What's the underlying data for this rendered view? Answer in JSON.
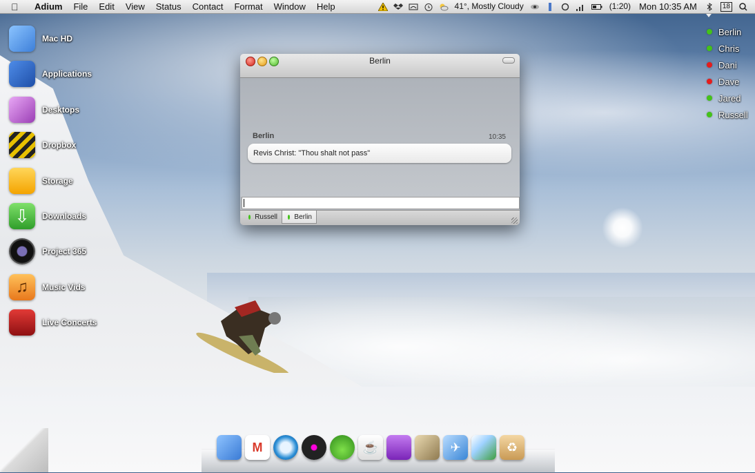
{
  "menubar": {
    "app": "Adium",
    "menus": [
      "File",
      "Edit",
      "View",
      "Status",
      "Contact",
      "Format",
      "Window",
      "Help"
    ],
    "weather": "41°, Mostly Cloudy",
    "battery": "(1:20)",
    "clock": "Mon 10:35 AM",
    "calendar_day": "18"
  },
  "desktop_icons": [
    {
      "label": "Mac HD",
      "icon": "finder-icon",
      "color": "#3d7fd9"
    },
    {
      "label": "Applications",
      "icon": "app-store-icon",
      "color": "#1f4fa8"
    },
    {
      "label": "Desktops",
      "icon": "desktops-icon",
      "color": "#9b3fb5"
    },
    {
      "label": "Dropbox",
      "icon": "dropbox-stripes-icon",
      "color": "#e8c100"
    },
    {
      "label": "Storage",
      "icon": "drive-icon",
      "color": "#f4b400"
    },
    {
      "label": "Downloads",
      "icon": "download-arrow-icon",
      "color": "#3fb53a"
    },
    {
      "label": "Project 365",
      "icon": "camera-lens-icon",
      "color": "#222222"
    },
    {
      "label": "Music Vids",
      "icon": "music-note-icon",
      "color": "#f08a1c"
    },
    {
      "label": "Live Concerts",
      "icon": "stage-icon",
      "color": "#b5191b"
    }
  ],
  "buddies": [
    {
      "name": "Berlin",
      "status": "online",
      "color": "#44c21a"
    },
    {
      "name": "Chris",
      "status": "online",
      "color": "#44c21a"
    },
    {
      "name": "Dani",
      "status": "away",
      "color": "#e51c1c"
    },
    {
      "name": "Dave",
      "status": "away",
      "color": "#e51c1c"
    },
    {
      "name": "Jared",
      "status": "online",
      "color": "#44c21a"
    },
    {
      "name": "Russell",
      "status": "online",
      "color": "#44c21a"
    }
  ],
  "chat": {
    "title": "Berlin",
    "message": {
      "sender": "Berlin",
      "time": "10:35",
      "text": "Revis Christ: \"Thou shalt not pass\""
    },
    "input_value": "",
    "tabs": [
      {
        "label": "Russell",
        "active": false
      },
      {
        "label": "Berlin",
        "active": true
      }
    ]
  },
  "dock": [
    {
      "icon": "finder-icon",
      "color": "#3a7bd5"
    },
    {
      "icon": "gmail-icon",
      "color": "#d93a2b"
    },
    {
      "icon": "safari-compass-icon",
      "color": "#2c8fd6"
    },
    {
      "icon": "itunes-icon",
      "color": "#222222"
    },
    {
      "icon": "adium-duck-icon",
      "color": "#4caf2a"
    },
    {
      "icon": "coffee-cup-icon",
      "color": "#ffffff"
    },
    {
      "icon": "popsicle-icon",
      "color": "#9a3fd0"
    },
    {
      "icon": "photo-slides-icon",
      "color": "#c8b48a"
    },
    {
      "icon": "mail-stamp-icon",
      "color": "#5aa0e0"
    },
    {
      "icon": "preview-icon",
      "color": "#3f9e3f"
    },
    {
      "icon": "trash-box-icon",
      "color": "#e0b878"
    }
  ]
}
